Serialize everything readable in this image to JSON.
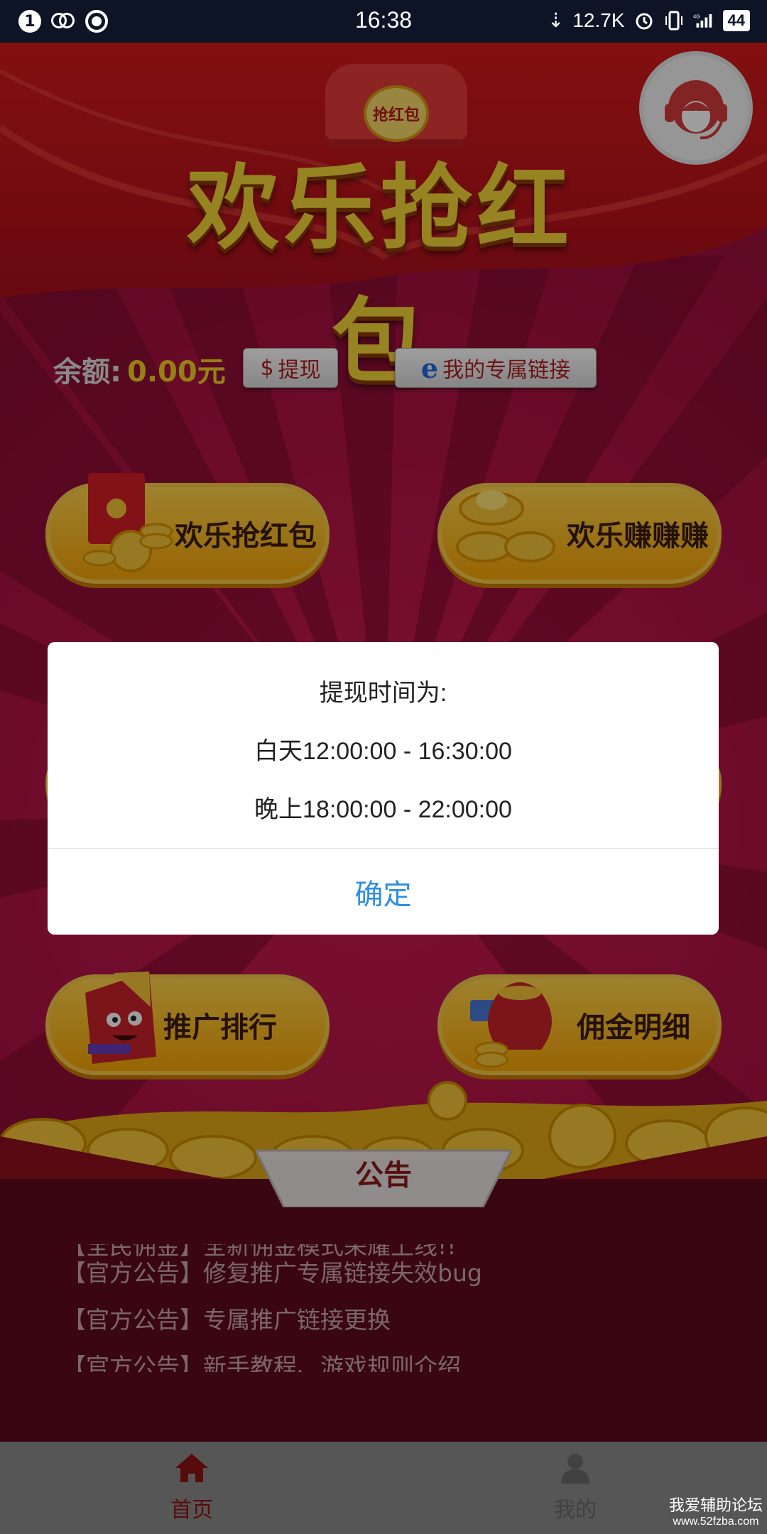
{
  "status_bar": {
    "notif_count": "1",
    "time": "16:38",
    "net_speed": "12.7K",
    "network_type": "4G",
    "battery": "44"
  },
  "header": {
    "title": "欢乐抢红包",
    "badge_text": "抢红包"
  },
  "balance": {
    "label": "余额:",
    "value": "0.00元",
    "withdraw_label": "提现",
    "my_link_label": "我的专属链接"
  },
  "menu": {
    "top_left": "欢乐抢红包",
    "top_right": "欢乐赚赚赚",
    "bottom_left": "推广排行",
    "bottom_right": "佣金明细"
  },
  "notice": {
    "title": "公告",
    "items": [
      "【全民佣金】全新佣金模式荣耀上线!!",
      "【官方公告】修复推广专属链接失效bug",
      "【官方公告】专属推广链接更换",
      "【官方公告】新手教程、游戏规则介绍"
    ]
  },
  "tabbar": {
    "home_label": "首页",
    "mine_label": "我的"
  },
  "watermark": {
    "line1": "我爱辅助论坛",
    "line2": "www.52fzba.com"
  },
  "dialog": {
    "title": "提现时间为:",
    "line_day": "白天12:00:00 - 16:30:00",
    "line_night": "晚上18:00:00 - 22:00:00",
    "confirm_label": "确定"
  },
  "colors": {
    "accent_gold": "#f3cf25",
    "dialog_button": "#2f8ee0",
    "active_tab": "#8e1212"
  }
}
